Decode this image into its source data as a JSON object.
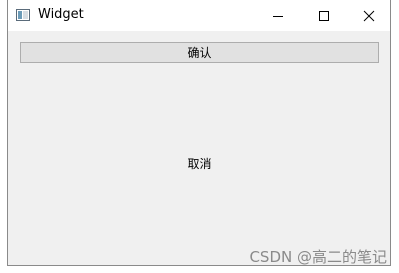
{
  "window": {
    "title": "Widget",
    "icon": "app-window-icon"
  },
  "titlebar_controls": {
    "minimize_icon": "minimize-icon",
    "maximize_icon": "maximize-icon",
    "close_icon": "close-icon"
  },
  "buttons": {
    "confirm_label": "确认",
    "cancel_label": "取消"
  },
  "watermark": {
    "text": "CSDN @高二的笔记"
  },
  "colors": {
    "client_background": "#f0f0f0",
    "titlebar_background": "#ffffff",
    "button_face": "#e1e1e1",
    "button_border": "#adadad",
    "watermark": "#8a8a8a"
  }
}
